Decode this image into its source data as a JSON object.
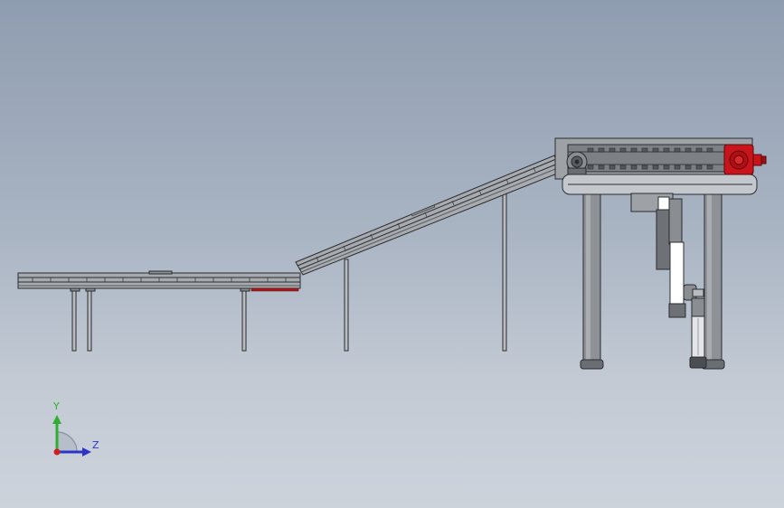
{
  "viewport": {
    "background_top": "#8f9db0",
    "background_bottom": "#cdd3db"
  },
  "model": {
    "frame_color": "#8a8d91",
    "outline_color": "#2a2c30",
    "drive_color": "#c8141a",
    "accent_color": "#a81818"
  },
  "triad": {
    "y_label": "Y",
    "z_label": "Z",
    "y_color": "#2fae2f",
    "z_color": "#2b36c8",
    "x_color": "#d01e1e"
  }
}
